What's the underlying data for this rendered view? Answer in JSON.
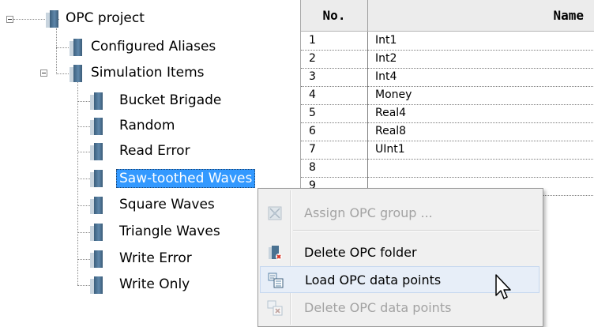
{
  "tree": {
    "root": {
      "label": "OPC project"
    },
    "children": [
      {
        "label": "Configured Aliases"
      },
      {
        "label": "Simulation Items",
        "expanded": true,
        "children": [
          {
            "label": "Bucket Brigade"
          },
          {
            "label": "Random"
          },
          {
            "label": "Read Error"
          },
          {
            "label": "Saw-toothed Waves",
            "selected": true
          },
          {
            "label": "Square Waves"
          },
          {
            "label": "Triangle Waves"
          },
          {
            "label": "Write Error"
          },
          {
            "label": "Write Only"
          }
        ]
      }
    ]
  },
  "grid": {
    "columns": [
      "No.",
      "Name"
    ],
    "rows": [
      {
        "no": "1",
        "name": "Int1"
      },
      {
        "no": "2",
        "name": "Int2"
      },
      {
        "no": "3",
        "name": "Int4"
      },
      {
        "no": "4",
        "name": "Money"
      },
      {
        "no": "5",
        "name": "Real4"
      },
      {
        "no": "6",
        "name": "Real8"
      },
      {
        "no": "7",
        "name": "UInt1"
      },
      {
        "no": "8",
        "name": ""
      },
      {
        "no": "9",
        "name": ""
      }
    ]
  },
  "context_menu": {
    "items": [
      {
        "label": "Assign OPC group ...",
        "enabled": false,
        "icon": "assign-group-icon"
      },
      {
        "label": "Delete OPC folder",
        "enabled": true,
        "icon": "delete-folder-icon"
      },
      {
        "label": "Load OPC data points",
        "enabled": true,
        "highlighted": true,
        "icon": "load-datapoints-icon"
      },
      {
        "label": "Delete OPC data points",
        "enabled": false,
        "icon": "delete-datapoints-icon"
      }
    ]
  },
  "colors": {
    "selection": "#3399ff",
    "menu_background": "#f0f0f0",
    "folder_icon": "#4a7191"
  }
}
